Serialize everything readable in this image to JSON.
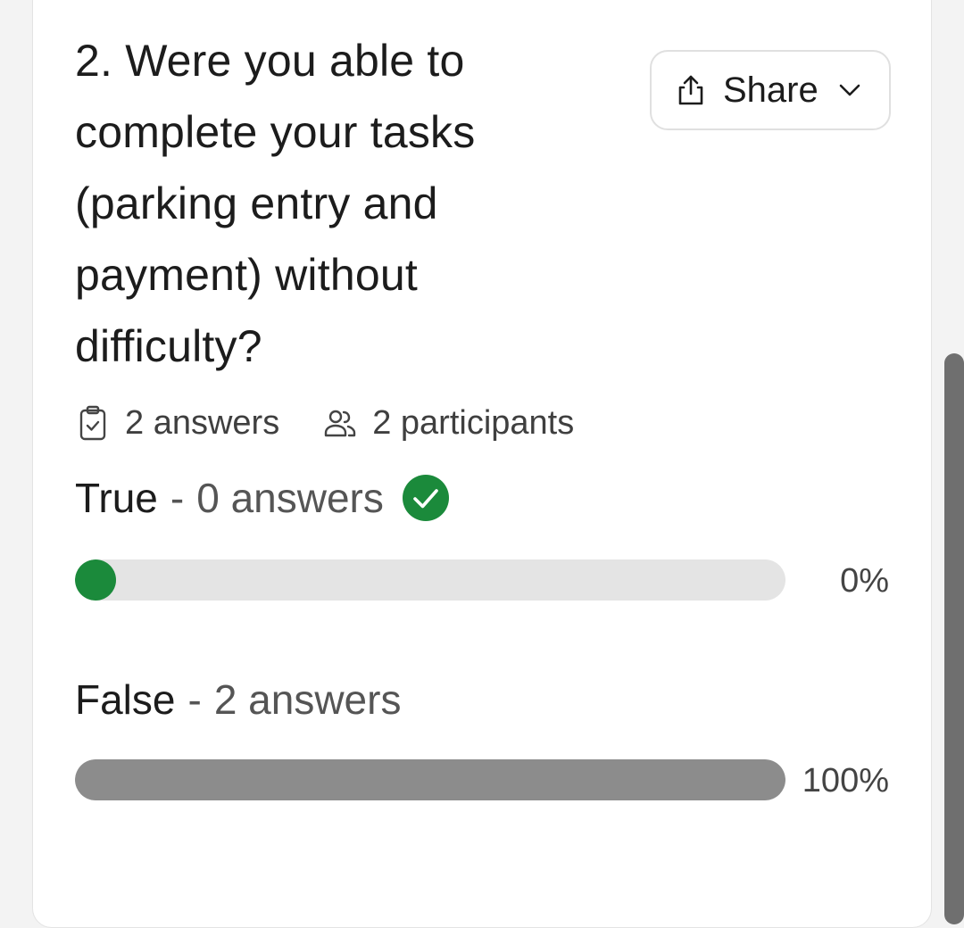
{
  "question": {
    "title": "2. Were you able to complete your tasks (parking entry and payment) without difficulty?"
  },
  "share": {
    "label": "Share",
    "icon": "share-upload-icon",
    "dropdown_icon": "chevron-down-icon"
  },
  "meta": {
    "answers": "2 answers",
    "answers_icon": "clipboard-check-icon",
    "participants": "2 participants",
    "participants_icon": "users-icon"
  },
  "options": [
    {
      "name": "True",
      "separator": "-",
      "count": "0 answers",
      "correct": true,
      "correct_icon": "check-circle-icon",
      "percent_label": "0%",
      "percent_value": 0,
      "bar_color": "#1b8a3b"
    },
    {
      "name": "False",
      "separator": "-",
      "count": "2 answers",
      "correct": false,
      "percent_label": "100%",
      "percent_value": 100,
      "bar_color": "#8c8c8c"
    }
  ],
  "colors": {
    "correct_green": "#1b8a3b",
    "track": "#e4e4e4",
    "neutral_fill": "#8c8c8c"
  }
}
